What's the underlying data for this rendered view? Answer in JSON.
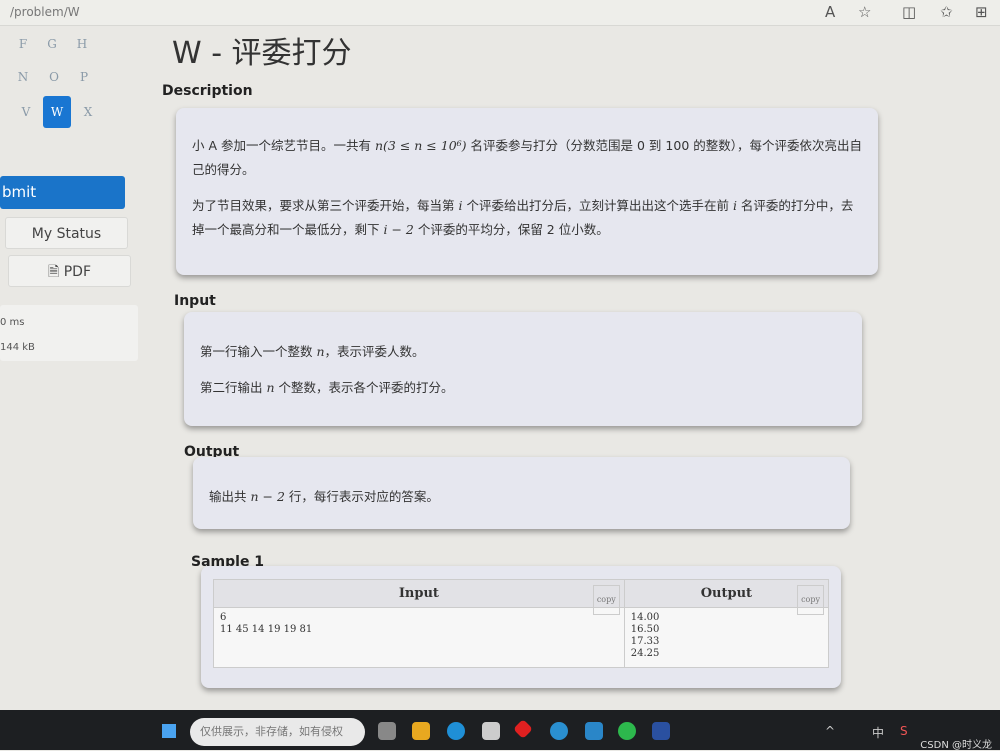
{
  "browser": {
    "tab_title": "/problem/W",
    "icons": [
      "read-aloud-icon",
      "favorite-icon",
      "split-screen-icon",
      "favorites-icon",
      "collections-icon"
    ]
  },
  "sidebar": {
    "problems": [
      "F",
      "G",
      "H",
      "N",
      "O",
      "P",
      "V",
      "W",
      "X"
    ],
    "active": "W",
    "submit_label": "bmit",
    "my_status_label": "My Status",
    "pdf_label": "PDF",
    "time_limit": "0 ms",
    "memory_limit": "144 kB"
  },
  "problem": {
    "title": "W - 评委打分",
    "description_heading": "Description",
    "description": {
      "p1_a": "小 A 参加一个综艺节目。一共有 ",
      "p1_math": "n(3 ≤ n ≤ 10⁶)",
      "p1_b": " 名评委参与打分（分数范围是 0 到 100 的整数），每个评委依次亮出自己的得分。",
      "p2_a": "为了节目效果，要求从第三个评委开始，每当第 ",
      "p2_i1": "i",
      "p2_b": " 个评委给出打分后，立刻计算出出这个选手在前 ",
      "p2_i2": "i",
      "p2_c": " 名评委的打分中，去掉一个最高分和一个最低分，剩下 ",
      "p2_math": "i − 2",
      "p2_d": " 个评委的平均分，保留 2 位小数。"
    },
    "input_heading": "Input",
    "input": {
      "l1_a": "第一行输入一个整数 ",
      "l1_n": "n",
      "l1_b": "，表示评委人数。",
      "l2_a": "第二行输出 ",
      "l2_n": "n",
      "l2_b": " 个整数，表示各个评委的打分。"
    },
    "output_heading": "Output",
    "output": {
      "a": "输出共 ",
      "math": "n − 2",
      "b": " 行，每行表示对应的答案。"
    },
    "sample": {
      "heading": "Sample 1",
      "input_label": "Input",
      "output_label": "Output",
      "copy_label": "copy",
      "input_text": "6\n11 45 14 19 19 81",
      "output_text": "14.00\n16.50\n17.33\n24.25"
    }
  },
  "taskbar": {
    "search_text": "仅供展示，非存储，如有侵权",
    "ime": "中",
    "watermark": "CSDN @时义龙",
    "accent": "#1a74c9"
  }
}
